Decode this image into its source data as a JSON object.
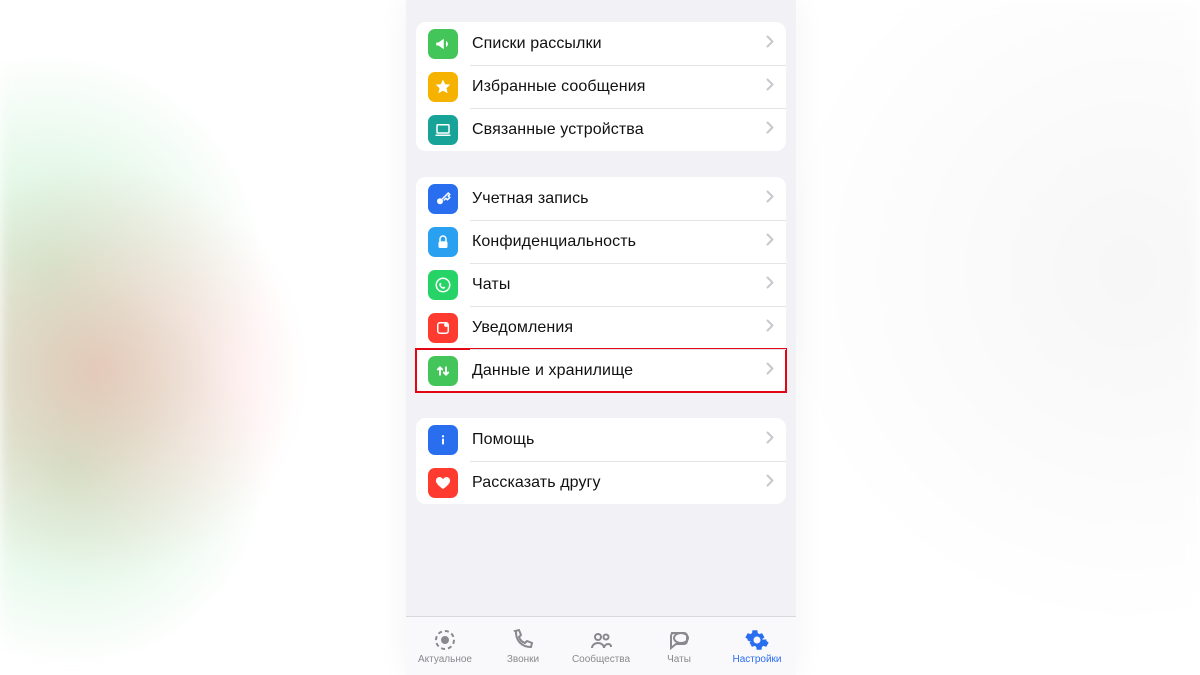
{
  "colors": {
    "green": "#44c55a",
    "yellow": "#f5bившь",
    "teal": "#17a398",
    "blue": "#2a6ef0",
    "lightblue": "#2aa0f0",
    "wa": "#25d366",
    "red": "#ff3b30",
    "grey": "#c7c7cc",
    "highlight": "#e30613"
  },
  "groups": [
    {
      "rows": [
        {
          "id": "broadcast",
          "icon": "megaphone",
          "bg": "#44c55a",
          "label": "Списки рассылки"
        },
        {
          "id": "starred",
          "icon": "star",
          "bg": "#f5b300",
          "label": "Избранные сообщения"
        },
        {
          "id": "linked",
          "icon": "laptop",
          "bg": "#17a398",
          "label": "Связанные устройства"
        }
      ]
    },
    {
      "rows": [
        {
          "id": "account",
          "icon": "key",
          "bg": "#2a6ef0",
          "label": "Учетная запись"
        },
        {
          "id": "privacy",
          "icon": "lock",
          "bg": "#2aa0f0",
          "label": "Конфиденциальность"
        },
        {
          "id": "chats",
          "icon": "wa",
          "bg": "#25d366",
          "label": "Чаты"
        },
        {
          "id": "notifications",
          "icon": "bell",
          "bg": "#ff3b30",
          "label": "Уведомления"
        },
        {
          "id": "storage",
          "icon": "updown",
          "bg": "#44c55a",
          "label": "Данные и хранилище",
          "highlight": true
        }
      ]
    },
    {
      "rows": [
        {
          "id": "help",
          "icon": "info",
          "bg": "#2a6ef0",
          "label": "Помощь"
        },
        {
          "id": "tell",
          "icon": "heart",
          "bg": "#ff3b30",
          "label": "Рассказать другу"
        }
      ]
    }
  ],
  "tabs": [
    {
      "id": "updates",
      "icon": "status",
      "label": "Актуальное"
    },
    {
      "id": "calls",
      "icon": "phone",
      "label": "Звонки"
    },
    {
      "id": "communities",
      "icon": "group",
      "label": "Сообщества"
    },
    {
      "id": "chats-tab",
      "icon": "chat",
      "label": "Чаты"
    },
    {
      "id": "settings",
      "icon": "gear",
      "label": "Настройки",
      "active": true
    }
  ]
}
